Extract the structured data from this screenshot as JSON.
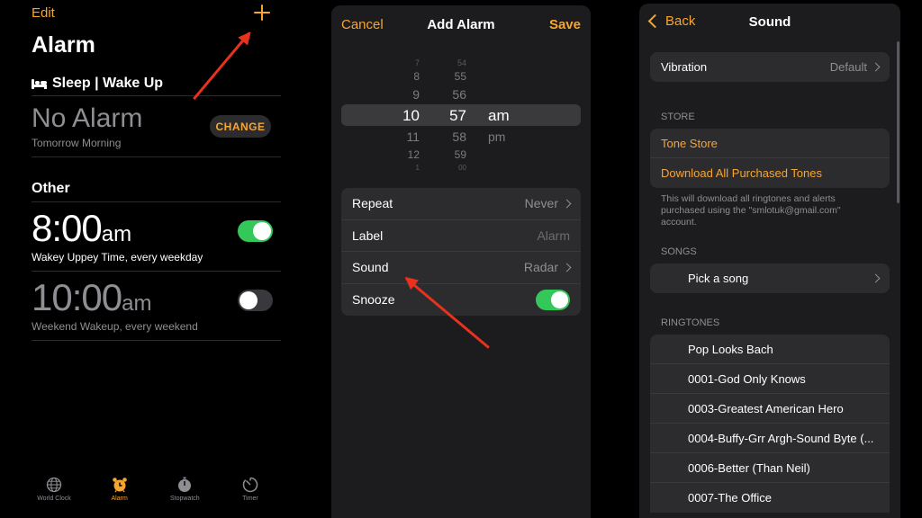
{
  "alarm_list": {
    "edit_label": "Edit",
    "add_icon": "plus-icon",
    "title": "Alarm",
    "sleep_header": "Sleep | Wake Up",
    "sleep_icon": "bed-icon",
    "no_alarm": "No Alarm",
    "tomorrow": "Tomorrow Morning",
    "change_label": "CHANGE",
    "other_header": "Other",
    "alarms": [
      {
        "time": "8:00",
        "ampm": "am",
        "subtitle": "Wakey Uppey Time, every weekday",
        "enabled": true
      },
      {
        "time": "10:00",
        "ampm": "am",
        "subtitle": "Weekend Wakeup, every weekend",
        "enabled": false
      }
    ],
    "tabs": [
      {
        "label": "World Clock",
        "icon": "globe-icon",
        "active": false
      },
      {
        "label": "Alarm",
        "icon": "alarm-clock-icon",
        "active": true
      },
      {
        "label": "Stopwatch",
        "icon": "stopwatch-icon",
        "active": false
      },
      {
        "label": "Timer",
        "icon": "timer-icon",
        "active": false
      }
    ]
  },
  "add_alarm": {
    "cancel_label": "Cancel",
    "title": "Add Alarm",
    "save_label": "Save",
    "picker": {
      "hours": [
        "7",
        "8",
        "9",
        "10",
        "11",
        "12",
        "1"
      ],
      "minutes": [
        "54",
        "55",
        "56",
        "57",
        "58",
        "59",
        "00"
      ],
      "periods": [
        "am",
        "pm"
      ]
    },
    "rows": {
      "repeat": {
        "label": "Repeat",
        "value": "Never"
      },
      "label": {
        "label": "Label",
        "placeholder": "Alarm"
      },
      "sound": {
        "label": "Sound",
        "value": "Radar"
      },
      "snooze": {
        "label": "Snooze",
        "enabled": true
      }
    }
  },
  "sound": {
    "back_label": "Back",
    "title": "Sound",
    "vibration": {
      "label": "Vibration",
      "value": "Default"
    },
    "store_header": "STORE",
    "tone_store": "Tone Store",
    "download_all": "Download All Purchased Tones",
    "download_note": "This will download all ringtones and alerts purchased using the \"smlotuk@gmail.com\" account.",
    "songs_header": "SONGS",
    "pick_song": "Pick a song",
    "ringtones_header": "RINGTONES",
    "ringtones": [
      "Pop Looks Bach",
      "0001-God Only Knows",
      "0003-Greatest American Hero",
      "0004-Buffy-Grr Argh-Sound Byte (...",
      "0006-Better (Than Neil)",
      "0007-The Office"
    ]
  },
  "colors": {
    "accent": "#f7a531",
    "toggle_on": "#34c759",
    "annotation_arrow": "#e8321e",
    "background": "#000000",
    "panel": "#1c1c1e"
  }
}
